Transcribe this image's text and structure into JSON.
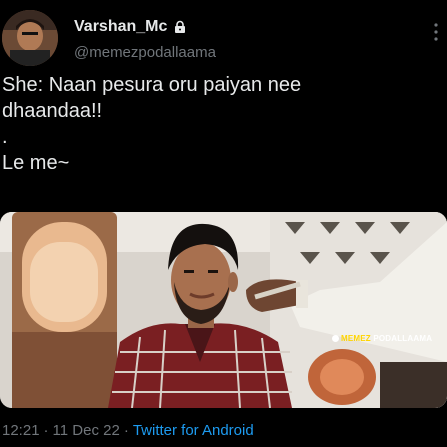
{
  "author": {
    "display_name": "Varshan_Mc",
    "handle": "@memezpodallaama",
    "protected_icon": "lock-icon"
  },
  "tweet": {
    "text": "She: Naan pesura oru paiyan nee\ndhaandaa!!\n.\nLe me~"
  },
  "media": {
    "watermark_prefix": "MEMEZ ",
    "watermark_suffix": "PODALLAAMA",
    "corner_text": "mt"
  },
  "footer": {
    "time": "12:21",
    "separator": "·",
    "date": "11 Dec 22",
    "separator2": "·",
    "source": "Twitter for Android"
  },
  "colors": {
    "background": "#000000",
    "text": "#e7e9ea",
    "muted": "#71767b",
    "link": "#1d9bf0",
    "watermark_accent": "#ffd400"
  }
}
